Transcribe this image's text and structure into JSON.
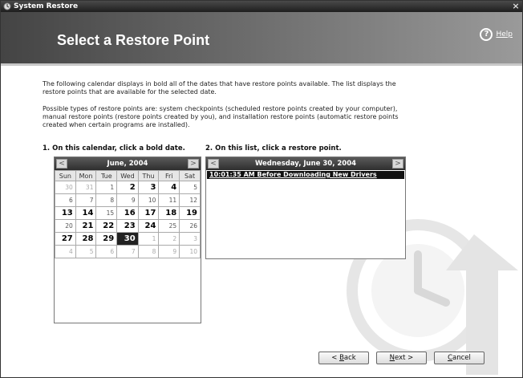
{
  "window": {
    "title": "System Restore",
    "close_glyph": "×"
  },
  "header": {
    "page_title": "Select a Restore Point",
    "help_label": "Help",
    "help_icon": "?"
  },
  "description": {
    "paragraph1": "The following calendar displays in bold all of the dates that have restore points available. The list displays the restore points that are available for the selected date.",
    "paragraph2": "Possible types of restore points are: system checkpoints (scheduled restore points created by your computer), manual restore points (restore points created by you), and installation restore points (automatic restore points created when certain programs are installed)."
  },
  "steps": {
    "step1": "1. On this calendar, click a bold date.",
    "step2": "2. On this list, click a restore point."
  },
  "calendar": {
    "month_label": "June, 2004",
    "prev_glyph": "<",
    "next_glyph": ">",
    "weekdays": [
      "Sun",
      "Mon",
      "Tue",
      "Wed",
      "Thu",
      "Fri",
      "Sat"
    ],
    "weeks": [
      [
        {
          "d": "30",
          "t": "other"
        },
        {
          "d": "31",
          "t": "other"
        },
        {
          "d": "1",
          "t": "normal"
        },
        {
          "d": "2",
          "t": "bold"
        },
        {
          "d": "3",
          "t": "bold"
        },
        {
          "d": "4",
          "t": "bold"
        },
        {
          "d": "5",
          "t": "normal"
        }
      ],
      [
        {
          "d": "6",
          "t": "normal"
        },
        {
          "d": "7",
          "t": "normal"
        },
        {
          "d": "8",
          "t": "normal"
        },
        {
          "d": "9",
          "t": "normal"
        },
        {
          "d": "10",
          "t": "normal"
        },
        {
          "d": "11",
          "t": "normal"
        },
        {
          "d": "12",
          "t": "normal"
        }
      ],
      [
        {
          "d": "13",
          "t": "bold"
        },
        {
          "d": "14",
          "t": "bold"
        },
        {
          "d": "15",
          "t": "normal"
        },
        {
          "d": "16",
          "t": "bold"
        },
        {
          "d": "17",
          "t": "bold"
        },
        {
          "d": "18",
          "t": "bold"
        },
        {
          "d": "19",
          "t": "bold"
        }
      ],
      [
        {
          "d": "20",
          "t": "normal"
        },
        {
          "d": "21",
          "t": "bold"
        },
        {
          "d": "22",
          "t": "bold"
        },
        {
          "d": "23",
          "t": "bold"
        },
        {
          "d": "24",
          "t": "bold"
        },
        {
          "d": "25",
          "t": "normal"
        },
        {
          "d": "26",
          "t": "normal"
        }
      ],
      [
        {
          "d": "27",
          "t": "bold"
        },
        {
          "d": "28",
          "t": "bold"
        },
        {
          "d": "29",
          "t": "bold"
        },
        {
          "d": "30",
          "t": "selected"
        },
        {
          "d": "1",
          "t": "other"
        },
        {
          "d": "2",
          "t": "other"
        },
        {
          "d": "3",
          "t": "other"
        }
      ],
      [
        {
          "d": "4",
          "t": "other"
        },
        {
          "d": "5",
          "t": "other"
        },
        {
          "d": "6",
          "t": "other"
        },
        {
          "d": "7",
          "t": "other"
        },
        {
          "d": "8",
          "t": "other"
        },
        {
          "d": "9",
          "t": "other"
        },
        {
          "d": "10",
          "t": "other"
        }
      ]
    ]
  },
  "restore_list": {
    "day_label": "Wednesday, June 30, 2004",
    "prev_glyph": "<",
    "next_glyph": ">",
    "items": [
      "10:01:35 AM  Before Downloading New Drivers"
    ]
  },
  "buttons": {
    "back_prefix": "< ",
    "back_key": "B",
    "back_rest": "ack",
    "next_label": "Next >",
    "next_key": "N",
    "next_rest": "ext >",
    "cancel_key": "C",
    "cancel_rest": "ancel"
  },
  "icons": {
    "app": "system-restore-icon",
    "help": "help-icon",
    "watermark": "clock-arrow-watermark-icon"
  },
  "colors": {
    "header_dark": "#444444",
    "selection": "#222222"
  }
}
